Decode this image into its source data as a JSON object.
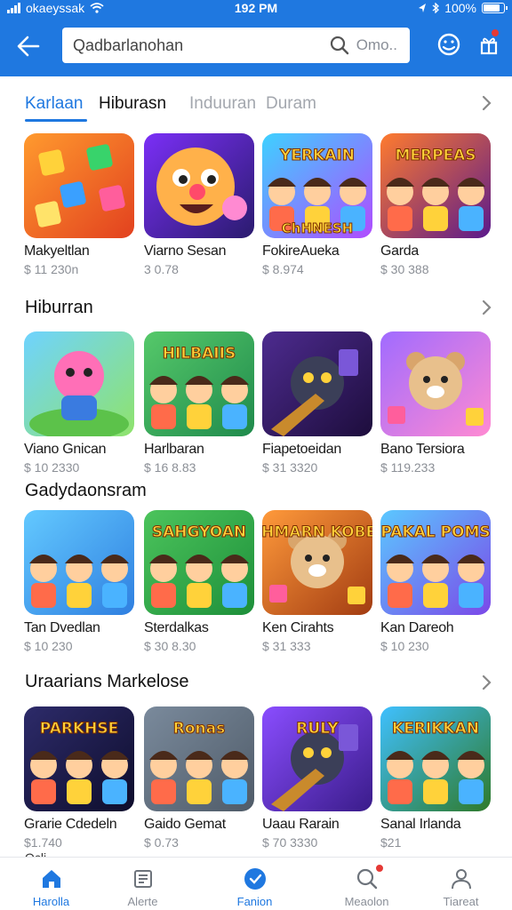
{
  "status": {
    "carrier": "okaeyssak",
    "time": "192 PM",
    "battery": "100%"
  },
  "search": {
    "value": "Qadbarlanohan",
    "extra": "Omo.."
  },
  "tabs": [
    {
      "label": "Karlaan"
    },
    {
      "label": "Hiburasn"
    },
    {
      "label": "Induuran"
    },
    {
      "label": "Duram"
    }
  ],
  "sections": [
    {
      "title": "",
      "apps": [
        {
          "name": "Makyeltlan",
          "price": "$ 11 230n",
          "theme": "blocks",
          "bg": [
            "#ff9a2e",
            "#e2411f"
          ]
        },
        {
          "name": "Viarno Sesan",
          "price": "3 0.78",
          "theme": "face",
          "bg": [
            "#7b2ff7",
            "#2a1b6e"
          ]
        },
        {
          "name": "FokireAueka",
          "price": "$ 8.974",
          "theme": "banner",
          "bg": [
            "#3dd1ff",
            "#b04bff"
          ],
          "art_text": "YERKAIN",
          "art_text2": "ChHNESH"
        },
        {
          "name": "Garda",
          "price": "$ 30 388",
          "theme": "heroes",
          "bg": [
            "#ff7b2e",
            "#5a1a8c"
          ],
          "art_text": "MERPEAS"
        }
      ]
    },
    {
      "title": "Hiburran",
      "apps": [
        {
          "name": "Viano Gnican",
          "price": "$ 10 2330",
          "theme": "monster",
          "bg": [
            "#6fd3ff",
            "#8fe36b"
          ]
        },
        {
          "name": "Harlbaran",
          "price": "$ 16 8.83",
          "theme": "heroes",
          "bg": [
            "#56c96a",
            "#1f8a4c"
          ],
          "art_text": "HILBAIIS"
        },
        {
          "name": "Fiapetoeidan",
          "price": "$ 31 3320",
          "theme": "robot",
          "bg": [
            "#4d2b8f",
            "#1d0d3c"
          ]
        },
        {
          "name": "Bano Tersiora",
          "price": "$ 119.233",
          "theme": "bear",
          "bg": [
            "#a06bff",
            "#ff8ad2"
          ]
        }
      ]
    },
    {
      "title": "Gadydaonsram",
      "apps": [
        {
          "name": "Tan Dvedlan",
          "price": "$ 10 230",
          "theme": "heroes",
          "bg": [
            "#63c9ff",
            "#2f7fe0"
          ]
        },
        {
          "name": "Sterdalkas",
          "price": "$ 30 8.30",
          "theme": "heroes",
          "bg": [
            "#4cc45c",
            "#1d8f3a"
          ],
          "art_text": "SAHGYOAN"
        },
        {
          "name": "Ken Cirahts",
          "price": "$ 31 333",
          "theme": "bear",
          "bg": [
            "#ff9a3b",
            "#a23c12"
          ],
          "art_text": "KAHMARN KOBELS"
        },
        {
          "name": "Kan Dareoh",
          "price": "$ 10 230",
          "theme": "heroes",
          "bg": [
            "#5bc8ff",
            "#7b48e8"
          ],
          "art_text": "PAKAL POMS"
        }
      ]
    },
    {
      "title": "Uraarians Markelose",
      "apps": [
        {
          "name": "Grarie Cdedeln",
          "price": "$1.740",
          "theme": "heroes",
          "bg": [
            "#2d2b6a",
            "#0e0d2c"
          ],
          "art_text": "PARKHSE"
        },
        {
          "name": "Gaido Gemat",
          "price": "$ 0.73",
          "theme": "heroes",
          "bg": [
            "#7a8a9c",
            "#4f5b68"
          ],
          "art_text": "Ronas"
        },
        {
          "name": "Uaau Rarain",
          "price": "$ 70 3330",
          "theme": "robot",
          "bg": [
            "#8a4dff",
            "#3a1c8a"
          ],
          "art_text": "RULY"
        },
        {
          "name": "Sanal Irlanda",
          "price": "$21",
          "theme": "heroes",
          "bg": [
            "#3fc0ff",
            "#2f7a2a"
          ],
          "art_text": "KERIKKAN"
        }
      ]
    }
  ],
  "partial_text": "Qcli",
  "bottom_nav": [
    {
      "label": "Harolla",
      "icon": "home-icon",
      "active": true
    },
    {
      "label": "Alerte",
      "icon": "news-icon",
      "active": false
    },
    {
      "label": "Fanion",
      "icon": "check-circle-icon",
      "active": true
    },
    {
      "label": "Meaolon",
      "icon": "search-icon",
      "active": false,
      "badge": true
    },
    {
      "label": "Tiareat",
      "icon": "person-icon",
      "active": false
    }
  ],
  "colors": {
    "accent": "#1f78e0",
    "header": "#1f78e0",
    "badge": "#e53935"
  }
}
